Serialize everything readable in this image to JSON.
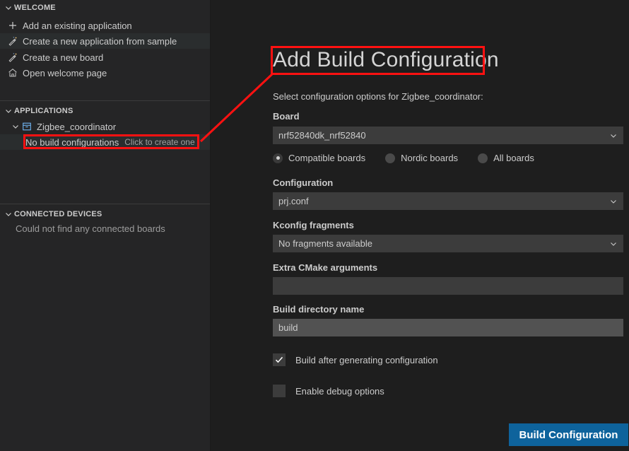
{
  "sidebar": {
    "sections": [
      {
        "id": "welcome",
        "title": "WELCOME",
        "twisty": "chevron-down-icon",
        "items": [
          {
            "label": "Add an existing application",
            "icon": "plus-icon",
            "selected": false
          },
          {
            "label": "Create a new application from sample",
            "icon": "wand-icon",
            "selected": true
          },
          {
            "label": "Create a new board",
            "icon": "wand-icon",
            "selected": false
          },
          {
            "label": "Open welcome page",
            "icon": "home-icon",
            "selected": false
          }
        ]
      },
      {
        "id": "applications",
        "title": "APPLICATIONS",
        "twisty": "chevron-down-icon",
        "items": [
          {
            "label": "Zigbee_coordinator",
            "icon": "archive-box-icon",
            "twisty": "chevron-down-icon",
            "selected": false
          },
          {
            "label": "No build configurations",
            "hint": "Click to create one",
            "icon": "none",
            "selected": true
          }
        ]
      },
      {
        "id": "connected-devices",
        "title": "CONNECTED DEVICES",
        "twisty": "chevron-down-icon",
        "items": [
          {
            "label": "Could not find any connected boards",
            "icon": "none",
            "selected": false
          }
        ]
      }
    ]
  },
  "main": {
    "title": "Add Build Configuration",
    "subtitle": "Select configuration options for Zigbee_coordinator:",
    "fields": {
      "board": {
        "label": "Board",
        "value": "nrf52840dk_nrf52840",
        "chevron": "chevron-down-icon"
      },
      "board_filter": {
        "options": [
          {
            "label": "Compatible boards",
            "selected": true
          },
          {
            "label": "Nordic boards",
            "selected": false
          },
          {
            "label": "All boards",
            "selected": false
          }
        ]
      },
      "configuration": {
        "label": "Configuration",
        "value": "prj.conf",
        "chevron": "chevron-down-icon"
      },
      "kconfig_fragments": {
        "label": "Kconfig fragments",
        "value": "No fragments available",
        "chevron": "chevron-down-icon"
      },
      "extra_cmake_arguments": {
        "label": "Extra CMake arguments",
        "value": "",
        "placeholder": ""
      },
      "build_directory_name": {
        "label": "Build directory name",
        "value": "build"
      }
    },
    "checkboxes": [
      {
        "label": "Build after generating configuration",
        "checked": true
      },
      {
        "label": "Enable debug options",
        "checked": false
      }
    ],
    "primary_button": "Build Configuration"
  },
  "annotation": {
    "color": "#ff1111",
    "highlight_title": "Add Build Configuration",
    "highlight_sidebar_row": "No build configurations"
  },
  "colors": {
    "editor_background": "#1e1e1e",
    "sidebar_background": "#252526",
    "selection": "#2a2d2e",
    "input_background": "#3c3c3c",
    "input_background_light": "#525252",
    "button_primary": "#0e639c",
    "text": "#cccccc",
    "accent_blue": "#75beff",
    "annotation_red": "#ff1111"
  }
}
